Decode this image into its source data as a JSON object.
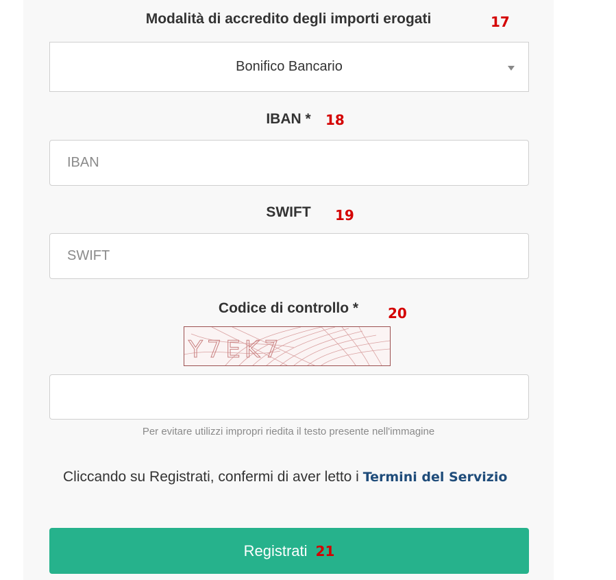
{
  "payment": {
    "label": "Modalità di accredito degli importi erogati",
    "marker": "17",
    "selected": "Bonifico Bancario"
  },
  "iban": {
    "label": "IBAN *",
    "marker": "18",
    "placeholder": "IBAN"
  },
  "swift": {
    "label": "SWIFT",
    "marker": "19",
    "placeholder": "SWIFT"
  },
  "captcha": {
    "label": "Codice di controllo *",
    "marker": "20",
    "image_text": "Y7EK7",
    "hint": "Per evitare utilizzi impropri riedita il testo presente nell'immagine"
  },
  "terms": {
    "prefix": "Cliccando su Registrati, confermi di aver letto i ",
    "link": "Termini del Servizio"
  },
  "submit": {
    "label": "Registrati",
    "marker": "21",
    "color": "#26b28c"
  },
  "icons": {
    "select_caret": "chevron-down-icon"
  }
}
